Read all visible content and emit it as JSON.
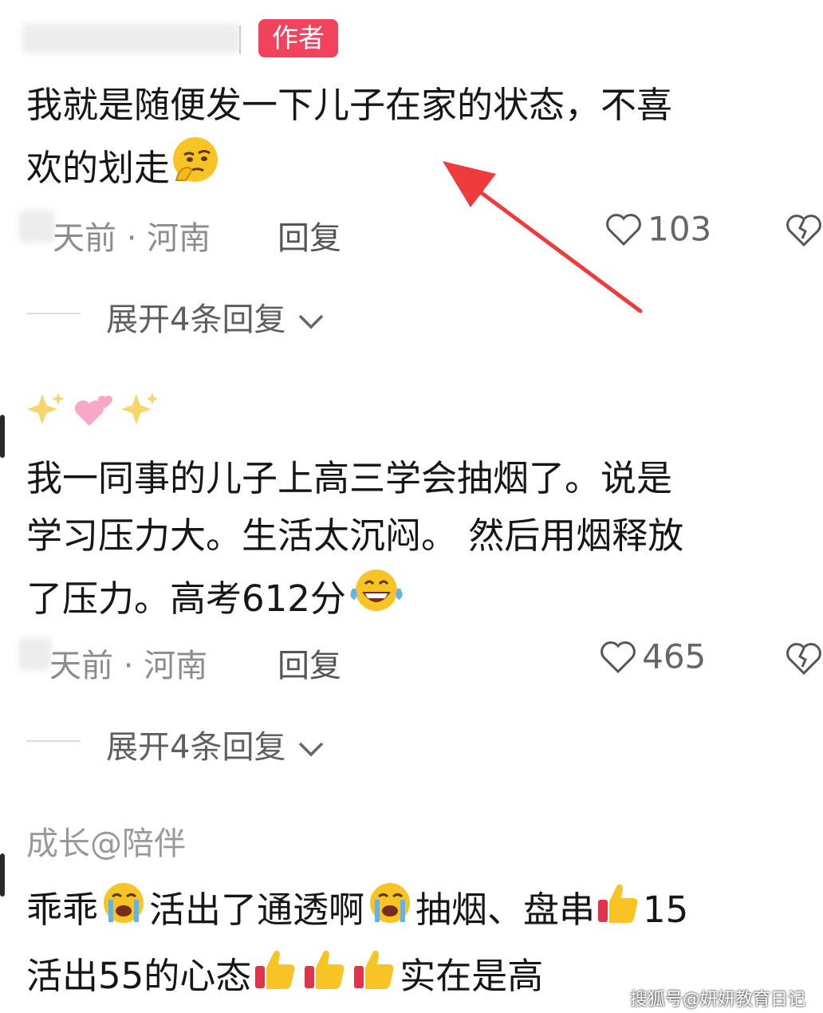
{
  "comments": [
    {
      "author_badge": "作者",
      "lines": [
        "我就是随便发一下儿子在家的状态，不喜",
        "欢的划走"
      ],
      "emoji_after": "thinking-face",
      "time_loc": "天前 · 河南",
      "reply_label": "回复",
      "like_count": "103",
      "expand_label": "展开4条回复"
    },
    {
      "username_emojis": "✨💕✨",
      "lines": [
        "我一同事的儿子上高三学会抽烟了。说是",
        "学习压力大。生活太沉闷。 然后用烟释放",
        "了压力。高考612分"
      ],
      "time_loc": "天前 · 河南",
      "reply_label": "回复",
      "like_count": "465",
      "expand_label": "展开4条回复"
    },
    {
      "username": "成长@陪伴",
      "line1_parts": [
        "乖乖",
        "活出了通透啊",
        "抽烟、盘串",
        "15"
      ],
      "line2_parts": [
        "活出55的心态",
        "实在是高"
      ]
    }
  ],
  "watermark": "搜狐号@妍妍教育日记",
  "colors": {
    "badge": "#f2435e",
    "arrow": "#ee3b3b"
  }
}
